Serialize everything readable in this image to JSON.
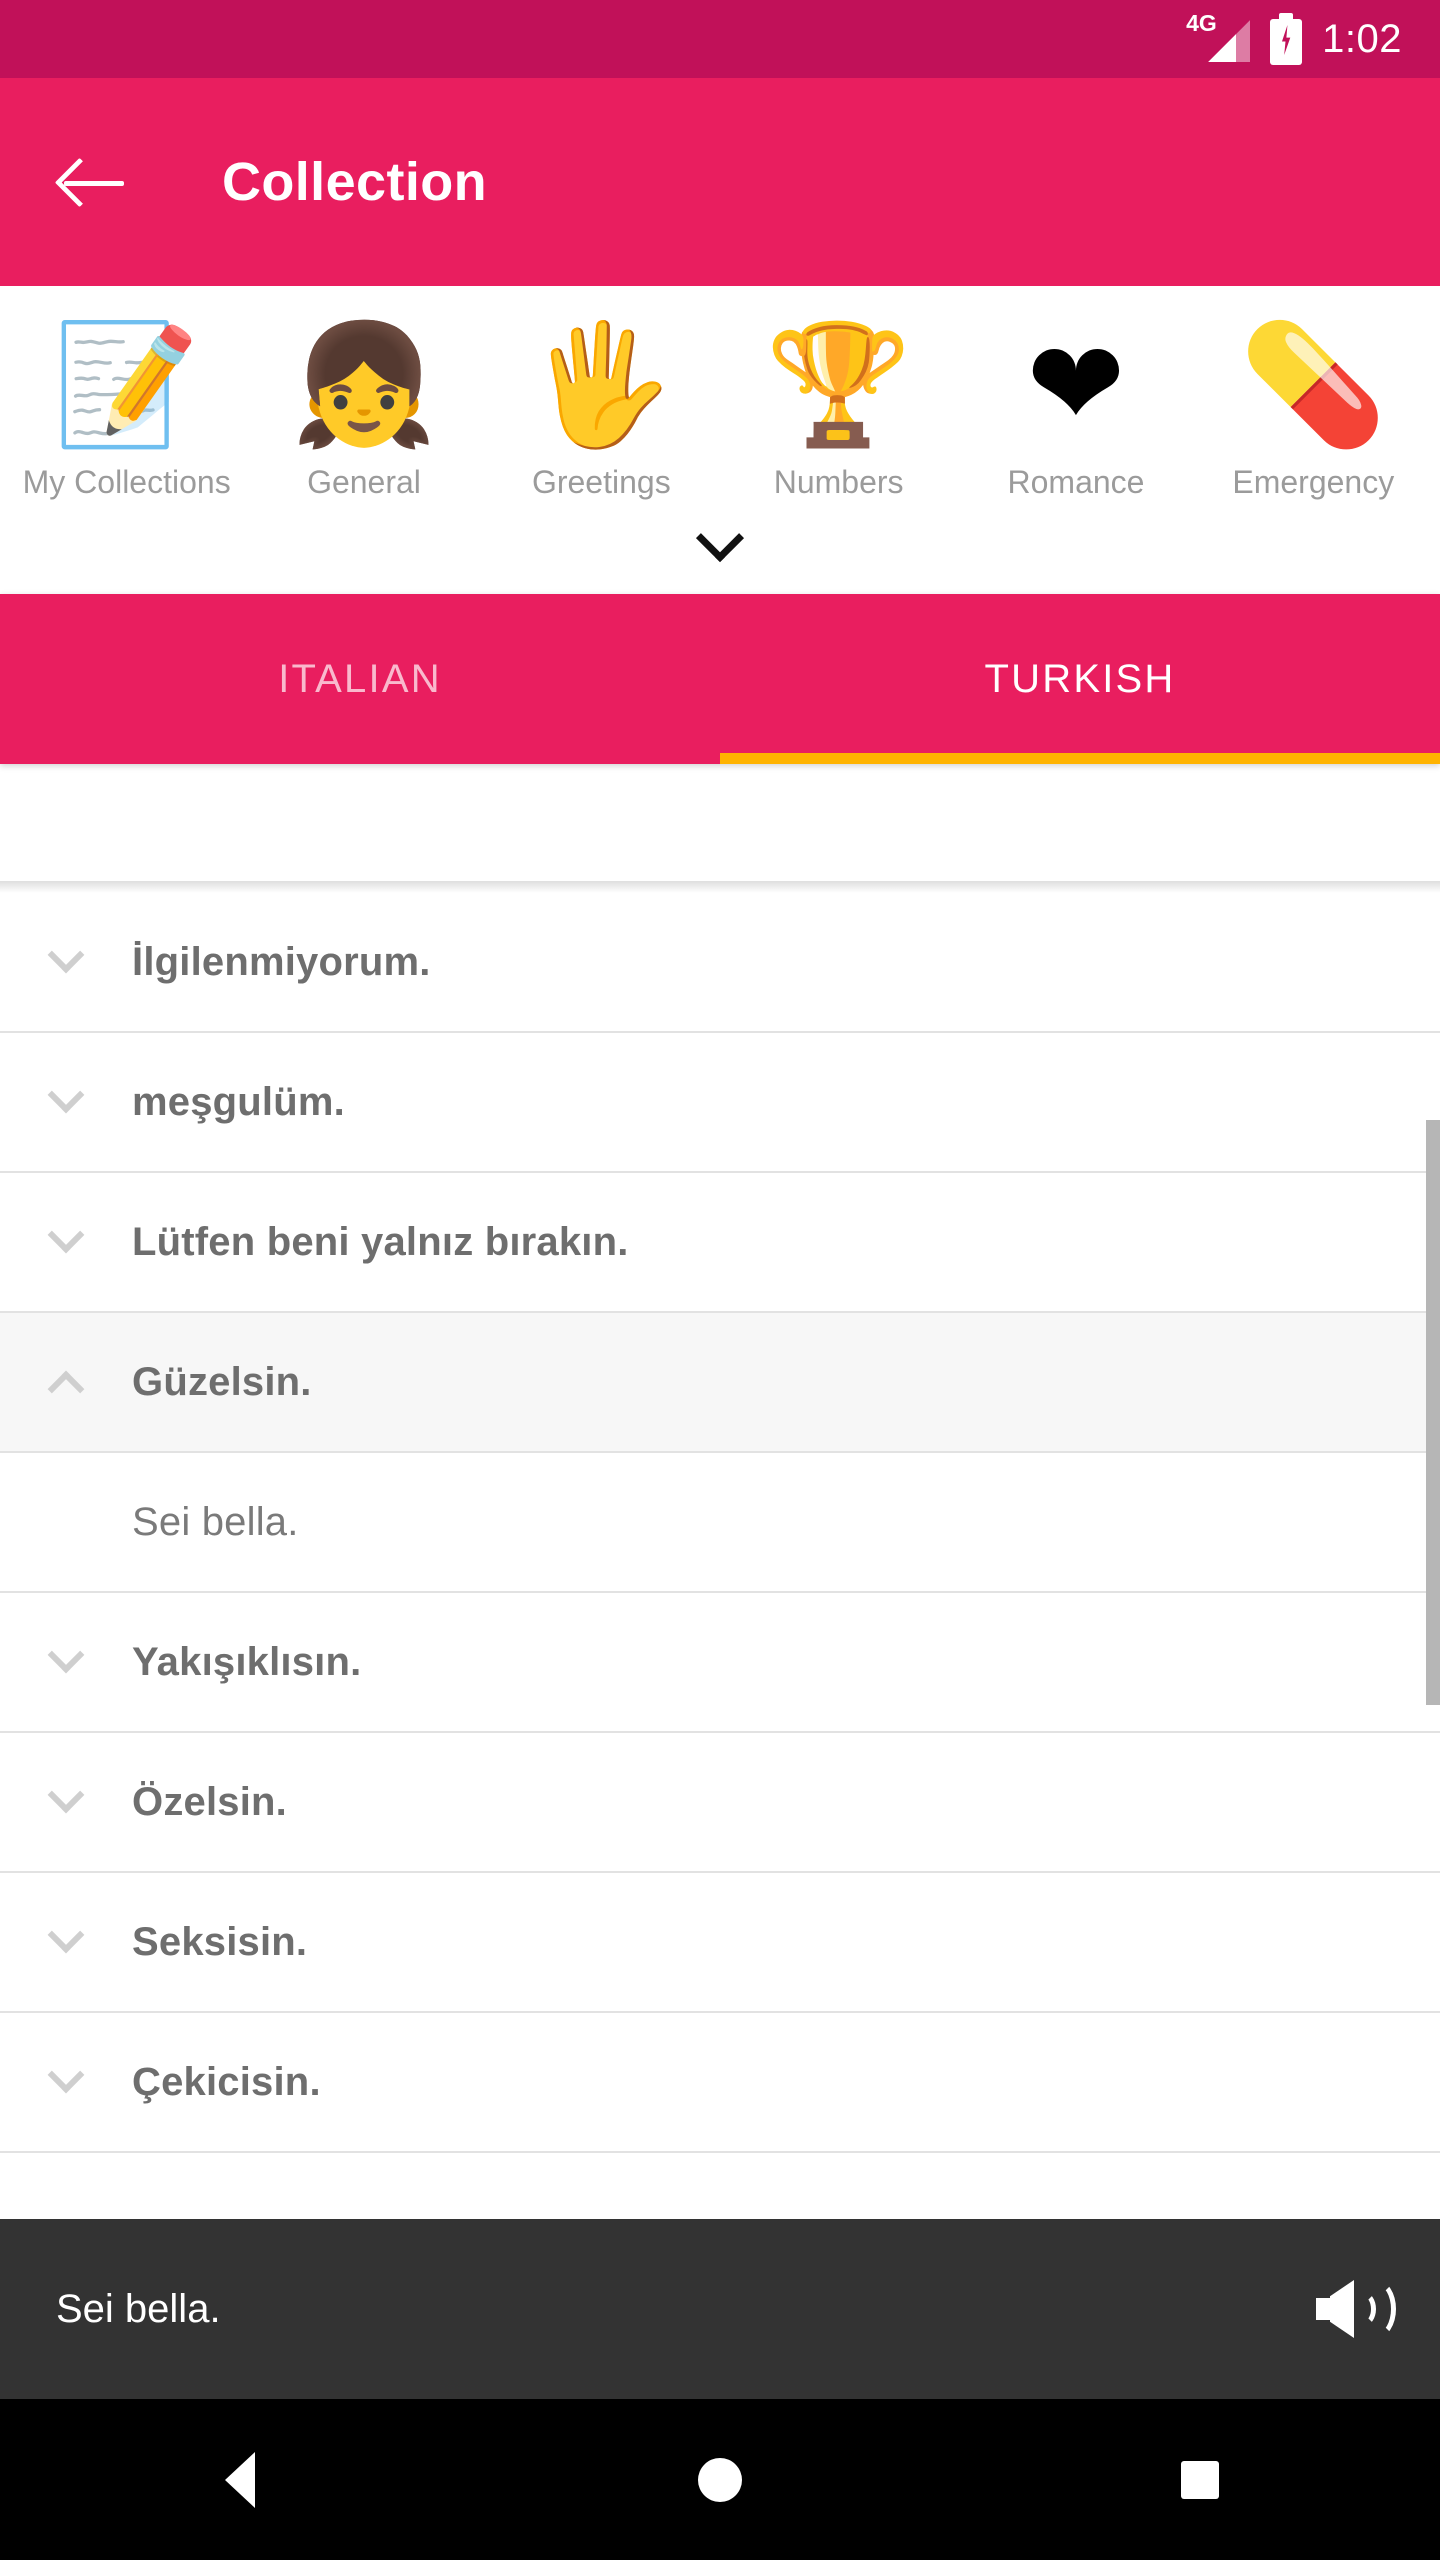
{
  "status_bar": {
    "network_label": "4G",
    "time": "1:02",
    "battery_state": "charging",
    "background_color": "#c11159"
  },
  "app_bar": {
    "title": "Collection",
    "back_icon": "arrow-left-icon",
    "background_color": "#e91e5f"
  },
  "categories": {
    "expand_icon": "chevron-down-icon",
    "items": [
      {
        "label": "My Collections",
        "icon": "memo-pencil-icon",
        "glyph": "📝"
      },
      {
        "label": "General",
        "icon": "girl-face-icon",
        "glyph": "👧"
      },
      {
        "label": "Greetings",
        "icon": "open-hand-icon",
        "glyph": "🖐"
      },
      {
        "label": "Numbers",
        "icon": "podium-icon",
        "glyph": "🏆"
      },
      {
        "label": "Romance",
        "icon": "heart-icon",
        "glyph": "❤"
      },
      {
        "label": "Emergency",
        "icon": "first-aid-kit-icon",
        "glyph": "💊"
      }
    ]
  },
  "tabs": {
    "indicator_color": "#ffb300",
    "items": [
      {
        "label": "ITALIAN",
        "active": false
      },
      {
        "label": "TURKISH",
        "active": true
      }
    ]
  },
  "phrase_list": {
    "rows": [
      {
        "text": "İlgilenmiyorum.",
        "expanded": false,
        "chevron": "chevron-down-icon"
      },
      {
        "text": "meşgulüm.",
        "expanded": false,
        "chevron": "chevron-down-icon"
      },
      {
        "text": "Lütfen beni yalnız bırakın.",
        "expanded": false,
        "chevron": "chevron-down-icon"
      },
      {
        "text": "Güzelsin.",
        "expanded": true,
        "chevron": "chevron-up-icon"
      },
      {
        "text": "Sei bella.",
        "translation": true
      },
      {
        "text": "Yakışıklısın.",
        "expanded": false,
        "chevron": "chevron-down-icon"
      },
      {
        "text": "Özelsin.",
        "expanded": false,
        "chevron": "chevron-down-icon"
      },
      {
        "text": "Seksisin.",
        "expanded": false,
        "chevron": "chevron-down-icon"
      },
      {
        "text": "Çekicisin.",
        "expanded": false,
        "chevron": "chevron-down-icon"
      }
    ]
  },
  "player": {
    "text": "Sei bella.",
    "speaker_icon": "volume-up-icon",
    "background_color": "#333333"
  },
  "nav_bar": {
    "back": "triangle-back-icon",
    "home": "circle-home-icon",
    "recents": "square-recents-icon"
  }
}
